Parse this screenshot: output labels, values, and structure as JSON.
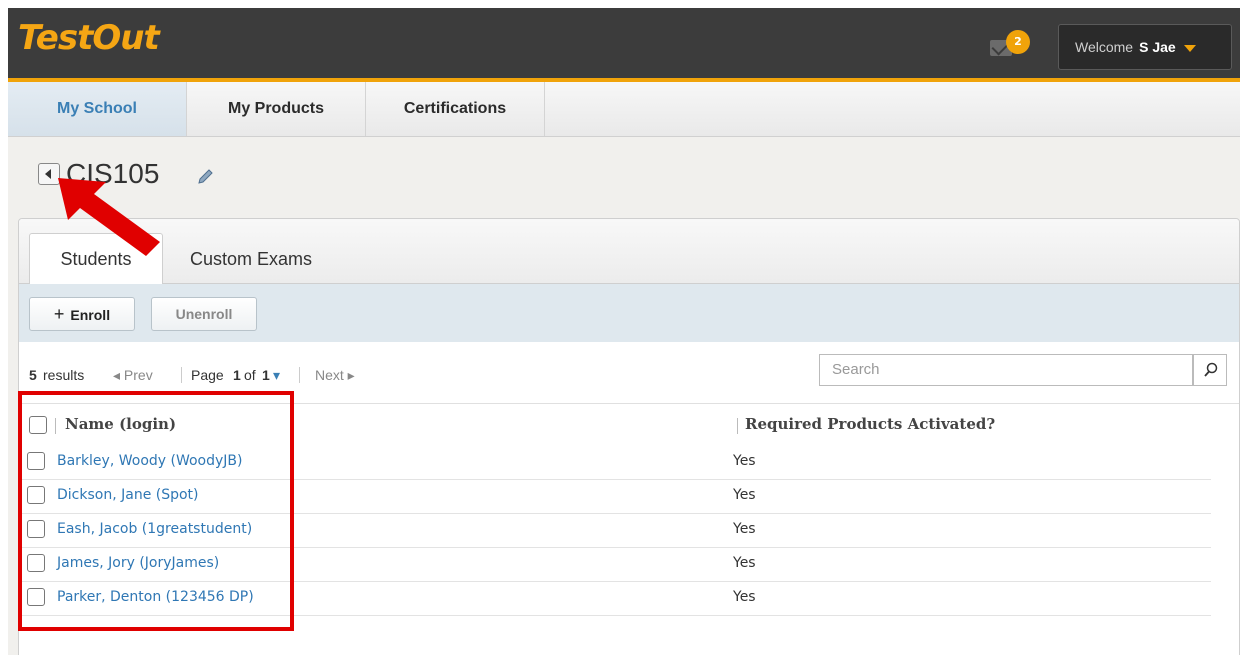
{
  "app": {
    "logo_text": "TestOut"
  },
  "header": {
    "mail_count": "2",
    "welcome_label": "Welcome",
    "user_name": "S Jae"
  },
  "nav": {
    "tabs": [
      {
        "label": "My School",
        "active": true
      },
      {
        "label": "My Products"
      },
      {
        "label": "Certifications"
      }
    ]
  },
  "page": {
    "title": "CIS105"
  },
  "panel_tabs": [
    {
      "label": "Students",
      "active": true
    },
    {
      "label": "Custom Exams"
    }
  ],
  "toolbar": {
    "enroll_label": "Enroll",
    "unenroll_label": "Unenroll"
  },
  "pager": {
    "results_count": "5",
    "results_label": "results",
    "prev_label": "Prev",
    "page_label": "Page",
    "page_current": "1",
    "of_label": "of",
    "page_total": "1",
    "next_label": "Next"
  },
  "search": {
    "placeholder": "Search"
  },
  "table": {
    "columns": [
      "Name (login)",
      "Required Products Activated?"
    ],
    "rows": [
      {
        "name": "Barkley, Woody (WoodyJB)",
        "activated": "Yes"
      },
      {
        "name": "Dickson, Jane (Spot)",
        "activated": "Yes"
      },
      {
        "name": "Eash, Jacob (1greatstudent)",
        "activated": "Yes"
      },
      {
        "name": "James, Jory (JoryJames)",
        "activated": "Yes"
      },
      {
        "name": "Parker, Denton (123456 DP)",
        "activated": "Yes"
      }
    ]
  },
  "colors": {
    "accent": "#f0a30a",
    "link": "#2f77b4",
    "annotation": "#e00000"
  }
}
